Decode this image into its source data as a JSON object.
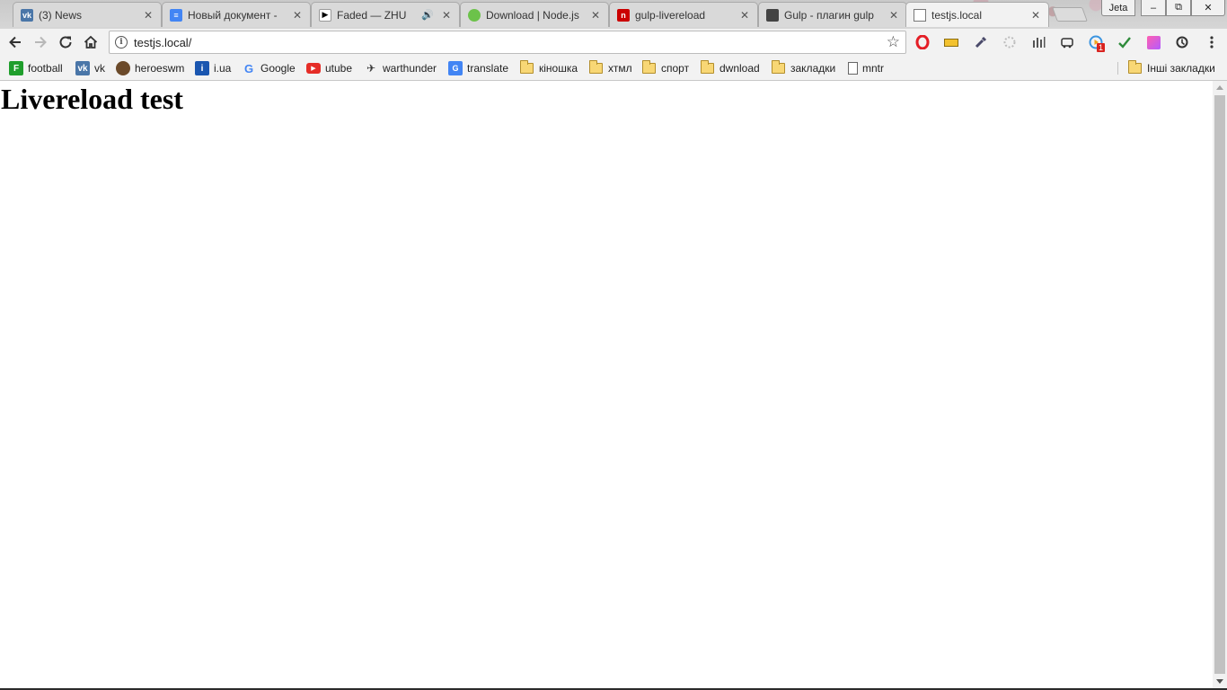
{
  "tabs": [
    {
      "title": "(3) News",
      "icon": "vk-icon"
    },
    {
      "title": "Новый документ -",
      "icon": "docs-icon"
    },
    {
      "title": "Faded — ZHU",
      "icon": "play-icon",
      "audio": "🔊"
    },
    {
      "title": "Download | Node.js",
      "icon": "nodejs-icon"
    },
    {
      "title": "gulp-livereload",
      "icon": "npm-icon"
    },
    {
      "title": "Gulp - плагин gulp",
      "icon": "gulp-icon"
    },
    {
      "title": "testjs.local",
      "icon": "page-icon",
      "active": true
    }
  ],
  "tab_close_glyph": "✕",
  "window": {
    "profile_label": "Jeta",
    "minimize": "–",
    "restore": "⧉",
    "close": "✕"
  },
  "toolbar": {
    "url": "testjs.local/",
    "info_glyph": "i",
    "star_glyph": "☆",
    "extensions_badge": "1"
  },
  "bookmarks": [
    {
      "label": "football",
      "icon": "football-icon"
    },
    {
      "label": "vk",
      "icon": "vk-icon"
    },
    {
      "label": "heroeswm",
      "icon": "heroeswm-icon"
    },
    {
      "label": "i.ua",
      "icon": "iua-icon"
    },
    {
      "label": "Google",
      "icon": "google-icon"
    },
    {
      "label": "utube",
      "icon": "youtube-icon"
    },
    {
      "label": "warthunder",
      "icon": "warthunder-icon"
    },
    {
      "label": "translate",
      "icon": "translate-icon"
    },
    {
      "label": "кіношка",
      "icon": "folder-icon"
    },
    {
      "label": "хтмл",
      "icon": "folder-icon"
    },
    {
      "label": "спорт",
      "icon": "folder-icon"
    },
    {
      "label": "dwnload",
      "icon": "folder-icon"
    },
    {
      "label": "закладки",
      "icon": "folder-icon"
    },
    {
      "label": "mntr",
      "icon": "page-icon"
    }
  ],
  "other_bookmarks": "Інші закладки",
  "page": {
    "heading": "Livereload test"
  },
  "colors": {
    "tab_active": "#f2f2f2",
    "tab_inactive": "#d9d9d9",
    "toolbar": "#f2f2f2",
    "scroll_thumb": "#c1c1c1"
  }
}
